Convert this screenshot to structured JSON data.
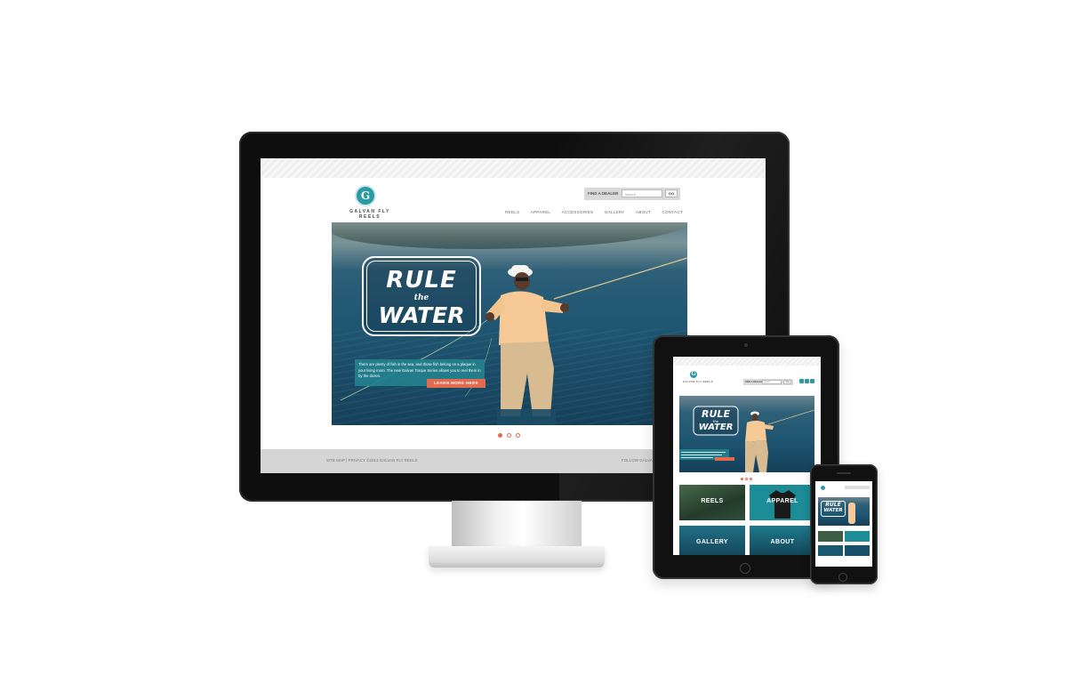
{
  "desktop": {
    "brand_initial": "G",
    "brand_name": "GALVAN FLY REELS",
    "find_dealer_label": "FIND A DEALER",
    "search_placeholder": "search",
    "go_label": "GO",
    "nav": [
      "REELS",
      "APPAREL",
      "ACCESSORIES",
      "GALLERY",
      "ABOUT",
      "CONTACT"
    ],
    "hero": {
      "rule_word": "RULE",
      "the_word": "the",
      "water_word": "WATER",
      "caption": "There are plenty of fish in the sea, and those fish belong on a plaque in your living room. The new Galvan Torque Series allows you to reel them in by the dozen.",
      "cta_label": "LEARN MORE HERE"
    },
    "slides": {
      "total": 3,
      "active": 1
    },
    "footer_left": "SITE MAP | PRIVACY ©2013 GALVAN FLY REELS",
    "footer_right": "FOLLOW GALVAN"
  },
  "tablet": {
    "brand_initial": "G",
    "tiles": [
      "REELS",
      "APPAREL",
      "GALLERY",
      "ABOUT"
    ],
    "hero_rule": "RULE",
    "hero_the": "the",
    "hero_water": "WATER"
  },
  "phone": {
    "hero_rule": "RULE",
    "hero_water": "WATER"
  },
  "colors": {
    "teal": "#2b9aa4",
    "accent": "#e36a4f",
    "footer_gray": "#d5d5d5",
    "bezel": "#0e0e0e"
  }
}
